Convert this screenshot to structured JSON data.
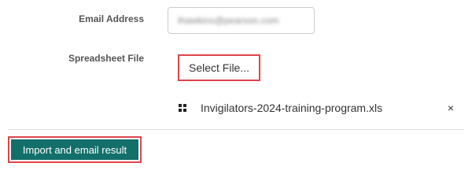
{
  "form": {
    "email_label": "Email Address",
    "email_value": "thawkins@pearson.com",
    "file_label": "Spreadsheet File",
    "select_file_label": "Select File...",
    "selected_file": {
      "name": "Invigilators-2024-training-program.xls",
      "file_icon": "file-grid-icon",
      "remove_icon": "close-icon",
      "remove_label": "×"
    },
    "submit_label": "Import and email result"
  },
  "colors": {
    "highlight": "#e0444b",
    "primary_button": "#126f6a"
  }
}
